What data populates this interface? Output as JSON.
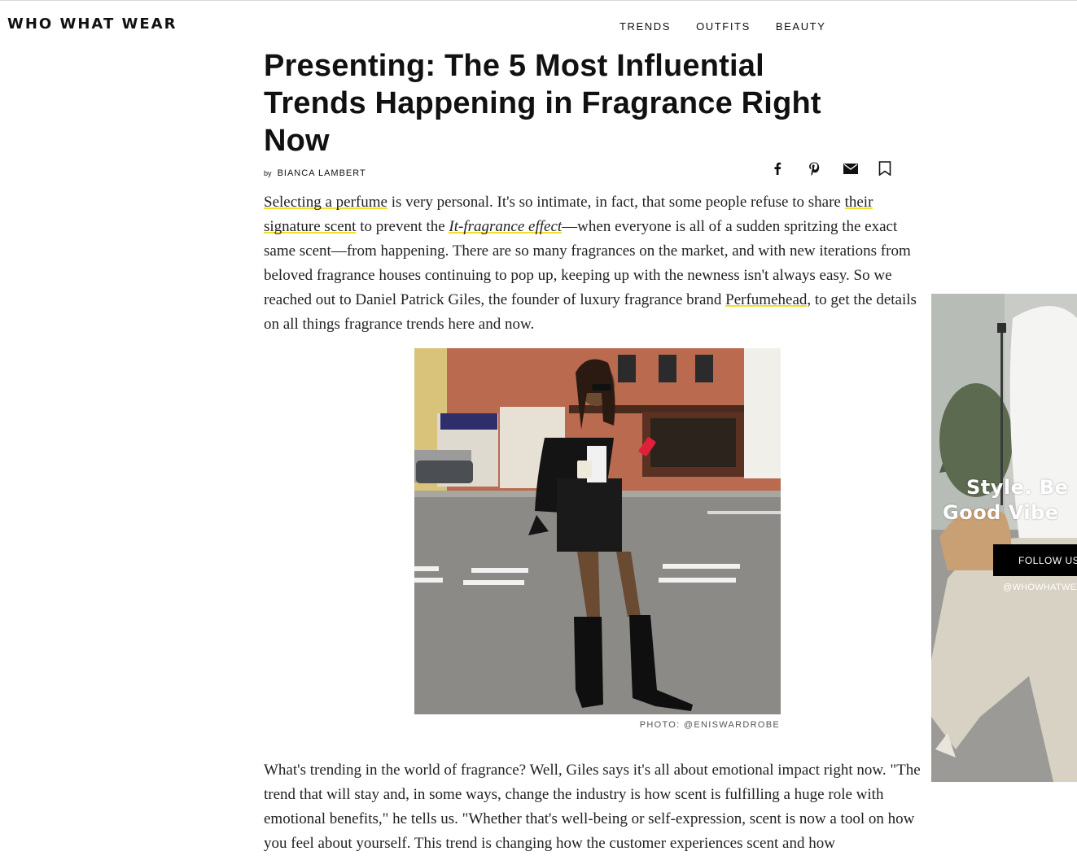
{
  "site": {
    "logo": "WHO WHAT WEAR"
  },
  "nav": {
    "items": [
      "TRENDS",
      "OUTFITS",
      "BEAUTY"
    ]
  },
  "article": {
    "title": "Presenting: The 5 Most Influential Trends Happening in Fragrance Right Now",
    "byline_prefix": "by",
    "author": "BIANCA LAMBERT",
    "share_icons": [
      "facebook-icon",
      "pinterest-icon",
      "email-icon",
      "bookmark-icon"
    ],
    "p1": {
      "link_perfume": "Selecting a perfume",
      "t1": " is very personal. It's so intimate, in fact, that some people refuse to share ",
      "link_signature": "their signature scent",
      "t2": " to prevent the ",
      "link_it": "It-fragrance effect",
      "t3": "—when everyone is all of a sudden spritzing the exact same scent—from happening. There are so many fragrances on the market, and with new iterations from beloved fragrance houses continuing to pop up, keeping up with the newness isn't always easy. So we reached out to Daniel Patrick Giles, the founder of luxury fragrance brand ",
      "link_perfumehead": "Perfumehead",
      "t4": ", to get the details on all things fragrance trends here and now."
    },
    "photo_credit": "PHOTO: @ENISWARDROBE",
    "p2": "What's trending in the world of fragrance? Well, Giles says it's all about emotional impact right now. \"The trend that will stay and, in some ways, change the industry is how scent is fulfilling a huge role with emotional benefits,\" he tells us. \"Whether that's well-being or self-expression, scent is now a tool on how you feel about yourself. This trend is changing how the customer experiences scent and how"
  },
  "promo": {
    "headline_line1": "Style. Be",
    "headline_line2": "Good Vibe",
    "follow_label": "FOLLOW US",
    "handle": "@WHOWHATWEA"
  },
  "colors": {
    "link_underline": "#f2df2a",
    "text": "#222222",
    "promo_button": "#000000"
  }
}
